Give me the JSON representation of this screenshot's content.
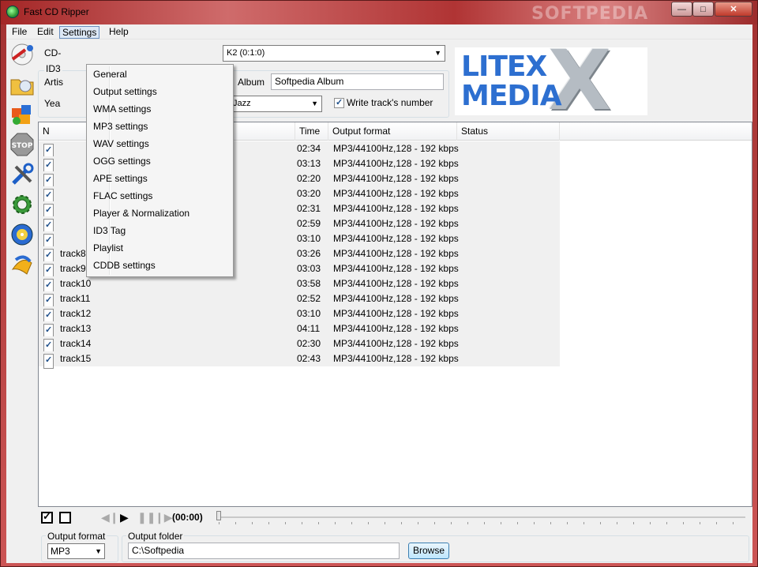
{
  "window": {
    "title": "Fast CD Ripper",
    "watermark": "SOFTPEDIA",
    "minimize": "0",
    "maximize": "1",
    "close": "r"
  },
  "menubar": {
    "items": [
      "File",
      "Edit",
      "Settings",
      "Help"
    ],
    "active": "Settings"
  },
  "settings_menu": {
    "items": [
      "General",
      "Output settings",
      "WMA settings",
      "MP3 settings",
      "WAV settings",
      "OGG settings",
      "APE settings",
      "FLAC settings",
      "Player & Normalization",
      "ID3 Tag",
      "Playlist",
      "CDDB settings"
    ]
  },
  "toolbar": {
    "icons": [
      "rip-icon",
      "open-folder-icon",
      "cddb-icon",
      "stop-icon",
      "tools-icon",
      "settings-gear-icon",
      "update-icon",
      "help-icon"
    ]
  },
  "cd_section": {
    "cd_label": "CD-",
    "drive_value": "K2 (0:1:0)",
    "id3_label": "ID3",
    "artist_label": "Artis",
    "year_label": "Yea",
    "album_label": "Album",
    "album_value": "Softpedia Album",
    "genre_value": "Jazz",
    "write_track_label": "Write track's number",
    "write_track_checked": true
  },
  "logo": {
    "line1": "LITEX",
    "line2": "MEDIA",
    "mark": "X"
  },
  "tracklist": {
    "headers": [
      "N",
      "Time",
      "Output format",
      "Status"
    ],
    "rows": [
      {
        "checked": true,
        "name": "",
        "time": "02:34",
        "format": "MP3/44100Hz,128 - 192 kbps",
        "status": ""
      },
      {
        "checked": true,
        "name": "",
        "time": "03:13",
        "format": "MP3/44100Hz,128 - 192 kbps",
        "status": ""
      },
      {
        "checked": true,
        "name": "",
        "time": "02:20",
        "format": "MP3/44100Hz,128 - 192 kbps",
        "status": ""
      },
      {
        "checked": true,
        "name": "",
        "time": "03:20",
        "format": "MP3/44100Hz,128 - 192 kbps",
        "status": ""
      },
      {
        "checked": true,
        "name": "",
        "time": "02:31",
        "format": "MP3/44100Hz,128 - 192 kbps",
        "status": ""
      },
      {
        "checked": true,
        "name": "",
        "time": "02:59",
        "format": "MP3/44100Hz,128 - 192 kbps",
        "status": ""
      },
      {
        "checked": true,
        "name": "",
        "time": "03:10",
        "format": "MP3/44100Hz,128 - 192 kbps",
        "status": ""
      },
      {
        "checked": true,
        "name": "track8",
        "time": "03:26",
        "format": "MP3/44100Hz,128 - 192 kbps",
        "status": ""
      },
      {
        "checked": true,
        "name": "track9",
        "time": "03:03",
        "format": "MP3/44100Hz,128 - 192 kbps",
        "status": ""
      },
      {
        "checked": true,
        "name": "track10",
        "time": "03:58",
        "format": "MP3/44100Hz,128 - 192 kbps",
        "status": ""
      },
      {
        "checked": true,
        "name": "track11",
        "time": "02:52",
        "format": "MP3/44100Hz,128 - 192 kbps",
        "status": ""
      },
      {
        "checked": true,
        "name": "track12",
        "time": "03:10",
        "format": "MP3/44100Hz,128 - 192 kbps",
        "status": ""
      },
      {
        "checked": true,
        "name": "track13",
        "time": "04:11",
        "format": "MP3/44100Hz,128 - 192 kbps",
        "status": ""
      },
      {
        "checked": true,
        "name": "track14",
        "time": "02:30",
        "format": "MP3/44100Hz,128 - 192 kbps",
        "status": ""
      },
      {
        "checked": true,
        "name": "track15",
        "time": "02:43",
        "format": "MP3/44100Hz,128 - 192 kbps",
        "status": ""
      }
    ]
  },
  "player": {
    "time": "(00:00)",
    "prev_icon": "previous-icon",
    "play_icon": "play-icon",
    "pause_icon": "pause-icon",
    "next_icon": "next-icon"
  },
  "output": {
    "format_label": "Output format",
    "format_value": "MP3",
    "folder_label": "Output folder",
    "folder_value": "C:\\Softpedia",
    "browse_label": "Browse"
  }
}
